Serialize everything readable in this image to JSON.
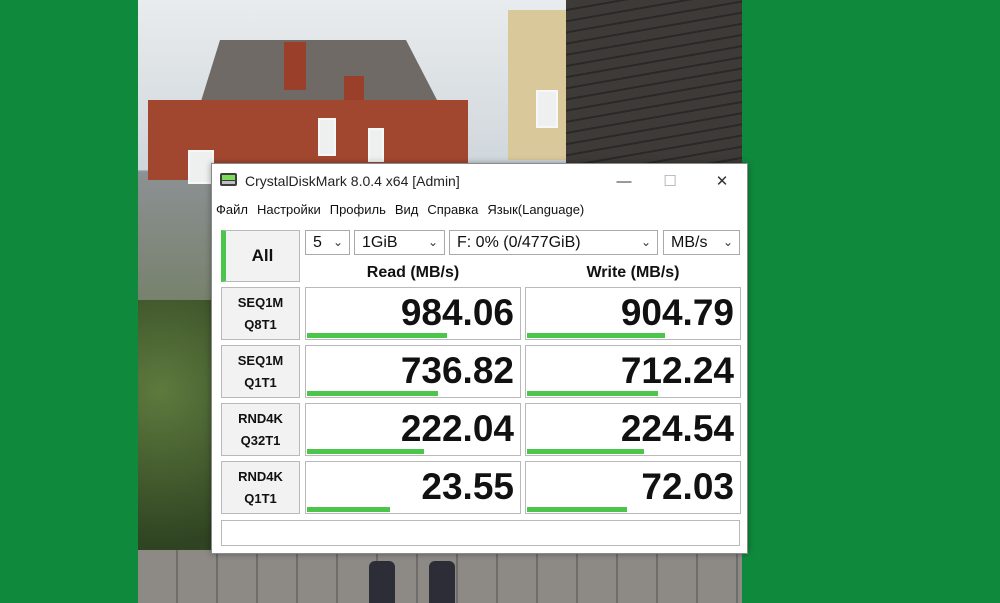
{
  "window": {
    "title": "CrystalDiskMark 8.0.4 x64 [Admin]",
    "controls": {
      "minimize": "—",
      "maximize": "☐",
      "close": "✕"
    }
  },
  "menu": [
    "Файл",
    "Настройки",
    "Профиль",
    "Вид",
    "Справка",
    "Язык(Language)"
  ],
  "toolbar": {
    "all_label": "All",
    "count": "5",
    "size": "1GiB",
    "drive": "F: 0% (0/477GiB)",
    "unit": "MB/s"
  },
  "headers": {
    "read": "Read (MB/s)",
    "write": "Write (MB/s)"
  },
  "rows": [
    {
      "line1": "SEQ1M",
      "line2": "Q8T1",
      "read": "984.06",
      "write": "904.79",
      "read_fill": 0.66,
      "write_fill": 0.65
    },
    {
      "line1": "SEQ1M",
      "line2": "Q1T1",
      "read": "736.82",
      "write": "712.24",
      "read_fill": 0.62,
      "write_fill": 0.62
    },
    {
      "line1": "RND4K",
      "line2": "Q32T1",
      "read": "222.04",
      "write": "224.54",
      "read_fill": 0.55,
      "write_fill": 0.55
    },
    {
      "line1": "RND4K",
      "line2": "Q1T1",
      "read": "23.55",
      "write": "72.03",
      "read_fill": 0.39,
      "write_fill": 0.47
    }
  ],
  "colors": {
    "accent": "#4cc64a",
    "background": "#0f8a3c"
  },
  "comment": ""
}
